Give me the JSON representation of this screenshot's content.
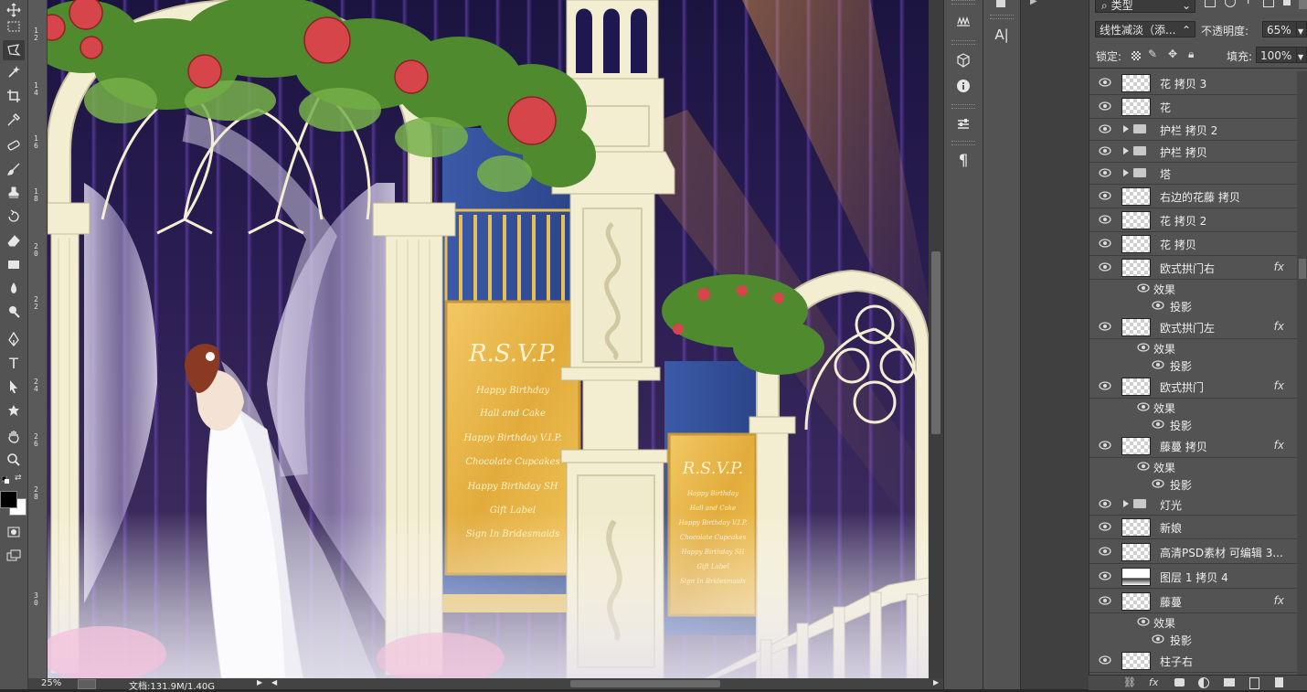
{
  "layers_panel": {
    "filter_kind": "类型",
    "blend_mode": "线性减淡（添...",
    "opacity_label": "不透明度:",
    "opacity_value": "65%",
    "lock_label": "锁定:",
    "fill_label": "填充:",
    "fill_value": "100%",
    "layers": [
      {
        "name": "花 拷贝 3",
        "type": "layer"
      },
      {
        "name": "花",
        "type": "layer"
      },
      {
        "name": "护栏 拷贝 2",
        "type": "group"
      },
      {
        "name": "护栏 拷贝",
        "type": "group"
      },
      {
        "name": "塔",
        "type": "group"
      },
      {
        "name": "右边的花藤 拷贝",
        "type": "layer"
      },
      {
        "name": "花 拷贝 2",
        "type": "layer"
      },
      {
        "name": "花 拷贝",
        "type": "layer"
      },
      {
        "name": "欧式拱门右",
        "type": "layer",
        "fx": "fx",
        "effects_label": "效果",
        "effect": "投影"
      },
      {
        "name": "欧式拱门左",
        "type": "layer",
        "fx": "fx",
        "effects_label": "效果",
        "effect": "投影"
      },
      {
        "name": "欧式拱门",
        "type": "layer",
        "fx": "fx",
        "effects_label": "效果",
        "effect": "投影"
      },
      {
        "name": "藤蔓 拷贝",
        "type": "layer",
        "fx": "fx",
        "effects_label": "效果",
        "effect": "投影"
      },
      {
        "name": "灯光",
        "type": "group"
      },
      {
        "name": "新娘",
        "type": "layer"
      },
      {
        "name": "高清PSD素材 可编辑 3...",
        "type": "layer"
      },
      {
        "name": "图层 1 拷贝 4",
        "type": "layer"
      },
      {
        "name": "藤蔓",
        "type": "layer",
        "fx": "fx",
        "effects_label": "效果",
        "effect": "投影"
      },
      {
        "name": "柱子右",
        "type": "layer"
      }
    ],
    "bottom_icons": [
      "link-icon",
      "fx-icon",
      "mask-icon",
      "adjustment-icon",
      "folder-icon",
      "new-layer-icon",
      "trash-icon"
    ],
    "fx_label": "fx"
  },
  "status": {
    "zoom": "25%",
    "doc_info": "文档:131.9M/1.40G"
  },
  "ruler": {
    "labels": [
      "1\n2",
      "1\n4",
      "1\n6",
      "1\n8",
      "2\n0",
      "2\n2",
      "2\n4",
      "2\n6",
      "2\n8",
      "3\n0"
    ]
  },
  "canvas": {
    "rsvp_title": "R.S.V.P.",
    "rsvp_lines": [
      "Happy Birthday",
      "Hall and Cake",
      "Happy Birthday V.I.P.",
      "Chocolate Cupcakes",
      "Happy Birthday SH",
      "Gift Label",
      "Sign In Bridesmaids"
    ]
  },
  "colors": {
    "panel_bg": "#535353",
    "dark_bg": "#282828",
    "ivory": "#f3eed2",
    "gold": "#e4b64a",
    "stage_purple": "#2a1d52"
  },
  "dock": {
    "text_tool_label": "A|",
    "paragraph_label": "¶"
  }
}
